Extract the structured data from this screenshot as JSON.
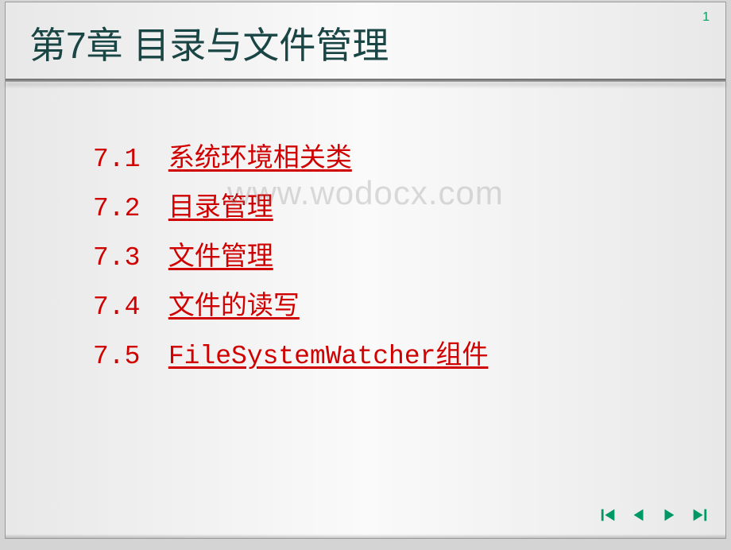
{
  "page_number": "1",
  "chapter_title": "第7章  目录与文件管理",
  "watermark": "www.wodocx.com",
  "toc": [
    {
      "number": "7.1",
      "label": "系统环境相关类"
    },
    {
      "number": "7.2",
      "label": "目录管理"
    },
    {
      "number": "7.3",
      "label": "文件管理"
    },
    {
      "number": "7.4",
      "label": "文件的读写"
    },
    {
      "number": "7.5",
      "label": "FileSystemWatcher组件"
    }
  ],
  "nav": {
    "first": "first",
    "prev": "prev",
    "next": "next",
    "last": "last"
  }
}
